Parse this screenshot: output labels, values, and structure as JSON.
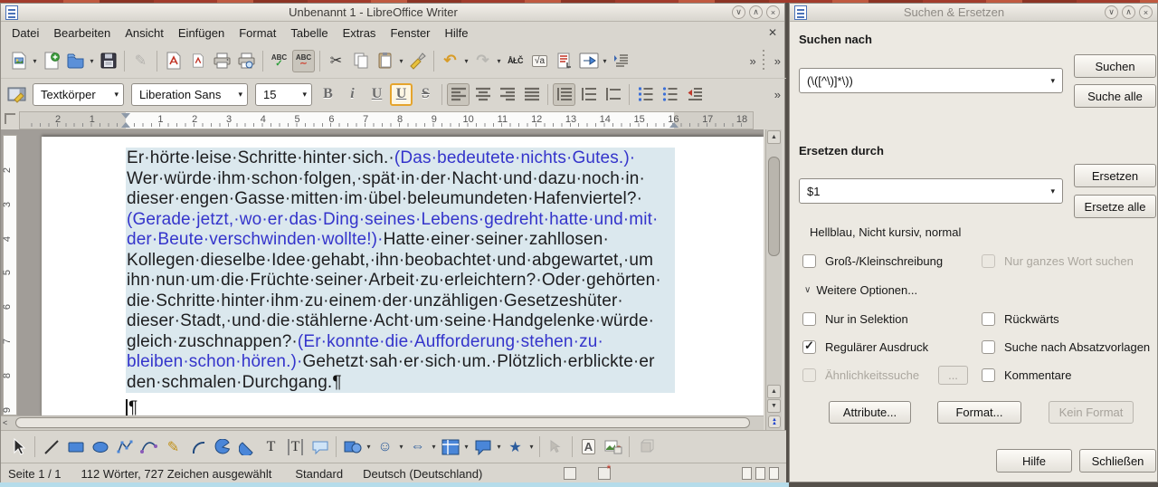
{
  "colors": {
    "selection_bg": "#dbe8ee",
    "blue_text": "#3434cb",
    "active_border": "#e5a42d",
    "titlebar_bg": "#f2efe9"
  },
  "glyphs": {
    "dropdown": "▾",
    "overflow": "»",
    "window_down": "∨",
    "window_up": "∧",
    "window_close": "×",
    "menu_close": "✕",
    "cut": "✂",
    "copy_hint": "",
    "special_chars": "ÅŁČ",
    "formula": "√a",
    "abc": "ABC",
    "check": "✓",
    "squiggle": "∼",
    "undo": "↶",
    "redo": "↷",
    "pencil": "✎",
    "bold": "B",
    "italic": "i",
    "underline": "U",
    "underline2": "U",
    "strike": "S",
    "star": "★",
    "block_arrows": "⇔",
    "smiley": "☺",
    "textbox": "T",
    "vertical_text": "T",
    "fontwork": "A",
    "pilcrow": "¶",
    "left_arrow": "<",
    "up_arrow": "▲",
    "down_arrow": "▼",
    "double_up": "▲\n▲",
    "double_down": "▼\n▼",
    "nav_dot": "●",
    "combo_chev": "▾",
    "expander": "∨"
  },
  "main": {
    "title": "Unbenannt 1 - LibreOffice Writer",
    "menu": [
      "Datei",
      "Bearbeiten",
      "Ansicht",
      "Einfügen",
      "Format",
      "Tabelle",
      "Extras",
      "Fenster",
      "Hilfe"
    ],
    "fmt": {
      "style": "Textkörper",
      "font": "Liberation Sans",
      "size": "15"
    },
    "ruler": {
      "h": [
        "2",
        "1",
        "",
        "1",
        "2",
        "3",
        "4",
        "5",
        "6",
        "7",
        "8",
        "9",
        "10",
        "11",
        "12",
        "13",
        "14",
        "15",
        "16",
        "17",
        "18"
      ],
      "v": [
        "2",
        "3",
        "4",
        "5",
        "6",
        "7",
        "8",
        "9"
      ]
    },
    "status": {
      "page": "Seite 1 / 1",
      "words": "112 Wörter, 727 Zeichen ausgewählt",
      "style": "Standard",
      "lang": "Deutsch (Deutschland)"
    }
  },
  "document": {
    "lines": [
      [
        {
          "t": "Er·hörte·leise·Schritte·hinter·sich.·",
          "c": "k"
        },
        {
          "t": "(Das·bedeutete·nichts·Gutes.)·",
          "c": "b"
        }
      ],
      [
        {
          "t": "Wer·würde·ihm·schon·folgen,·spät·in·der·Nacht·und·dazu·noch·in·",
          "c": "k"
        }
      ],
      [
        {
          "t": "dieser·engen·Gasse·mitten·im·übel·beleumundeten·Hafenviertel?·",
          "c": "k"
        }
      ],
      [
        {
          "t": "(Gerade·jetzt,·wo·er·das·Ding·seines·Lebens·gedreht·hatte·und·mit·",
          "c": "b"
        }
      ],
      [
        {
          "t": "der·Beute·verschwinden·wollte!)·",
          "c": "b"
        },
        {
          "t": "Hatte·einer·seiner·zahllosen·",
          "c": "k"
        }
      ],
      [
        {
          "t": "Kollegen·dieselbe·Idee·gehabt,·ihn·beobachtet·und·abgewartet,·um",
          "c": "k"
        }
      ],
      [
        {
          "t": "ihn·nun·um·die·Früchte·seiner·Arbeit·zu·erleichtern?·Oder·gehörten·",
          "c": "k"
        }
      ],
      [
        {
          "t": "die·Schritte·hinter·ihm·zu·einem·der·unzähligen·Gesetzeshüter·",
          "c": "k"
        }
      ],
      [
        {
          "t": "dieser·Stadt,·und·die·stählerne·Acht·um·seine·Handgelenke·würde·",
          "c": "k"
        }
      ],
      [
        {
          "t": "gleich·zuschnappen?·",
          "c": "k"
        },
        {
          "t": "(Er·konnte·die·Aufforderung·stehen·zu·",
          "c": "b"
        }
      ],
      [
        {
          "t": "bleiben·schon·hören.)·",
          "c": "b"
        },
        {
          "t": "Gehetzt·sah·er·sich·um.·Plötzlich·erblickte·er",
          "c": "k"
        }
      ],
      [
        {
          "t": "den·schmalen·Durchgang.",
          "c": "k"
        },
        {
          "t": "¶",
          "c": "p"
        }
      ]
    ],
    "after_mark": "¶"
  },
  "dialog": {
    "title": "Suchen & Ersetzen",
    "search_label": "Suchen nach",
    "search_value": "(\\([^\\)]*\\))",
    "replace_label": "Ersetzen durch",
    "replace_value": "$1",
    "replace_format": "Hellblau, Nicht kursiv, normal",
    "other_options": "Weitere Optionen...",
    "btn_search": "Suchen",
    "btn_search_all": "Suche alle",
    "btn_replace": "Ersetzen",
    "btn_replace_all": "Ersetze alle",
    "btn_similarity": "...",
    "btn_attributes": "Attribute...",
    "btn_format": "Format...",
    "btn_no_format": "Kein Format",
    "btn_help": "Hilfe",
    "btn_close": "Schließen",
    "checkboxes": {
      "match_case": {
        "label": "Groß-/Kleinschreibung",
        "checked": false,
        "disabled": false
      },
      "whole_words": {
        "label": "Nur ganzes Wort suchen",
        "checked": false,
        "disabled": true
      },
      "selection_only": {
        "label": "Nur in Selektion",
        "checked": false,
        "disabled": false
      },
      "backwards": {
        "label": "Rückwärts",
        "checked": false,
        "disabled": false
      },
      "regex": {
        "label": "Regulärer Ausdruck",
        "checked": true,
        "disabled": false
      },
      "paragraph_styles": {
        "label": "Suche nach Absatzvorlagen",
        "checked": false,
        "disabled": false
      },
      "similarity": {
        "label": "Ähnlichkeitssuche",
        "checked": false,
        "disabled": true
      },
      "comments": {
        "label": "Kommentare",
        "checked": false,
        "disabled": false
      }
    }
  }
}
